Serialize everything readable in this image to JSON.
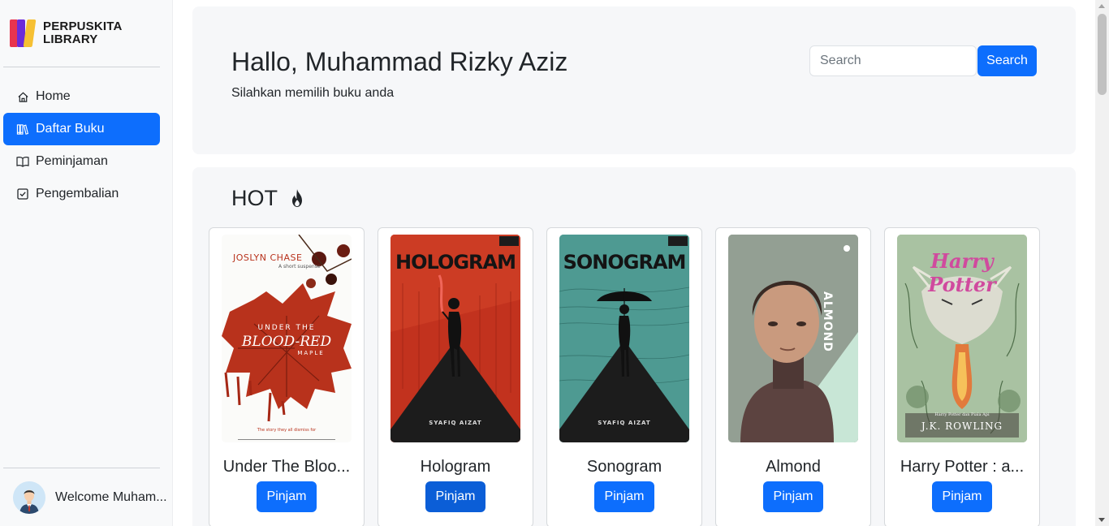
{
  "brand": {
    "line1": "PERPUSKITA",
    "line2": "LIBRARY"
  },
  "sidebar": {
    "items": [
      {
        "label": "Home",
        "icon": "home-icon"
      },
      {
        "label": "Daftar Buku",
        "icon": "books-icon",
        "active": true
      },
      {
        "label": "Peminjaman",
        "icon": "book-open-icon"
      },
      {
        "label": "Pengembalian",
        "icon": "check-square-icon"
      }
    ],
    "user_label": "Welcome Muham..."
  },
  "hero": {
    "greeting": "Hallo, Muhammad Rizky Aziz",
    "subtitle": "Silahkan memilih buku anda",
    "search_placeholder": "Search",
    "search_button": "Search"
  },
  "hot": {
    "title": "HOT",
    "books": [
      {
        "title": "Under The Bloo...",
        "button": "Pinjam",
        "cover_lines": [
          "JOSLYN CHASE",
          "A short suspense",
          "UNDER THE",
          "BLOOD-RED",
          "MAPLE",
          "The story they all dismiss for"
        ]
      },
      {
        "title": "Hologram",
        "button": "Pinjam",
        "cover_lines": [
          "HOLOGRAM",
          "SYAFIQ AIZAT"
        ]
      },
      {
        "title": "Sonogram",
        "button": "Pinjam",
        "cover_lines": [
          "SONOGRAM",
          "SYAFIQ AIZAT"
        ]
      },
      {
        "title": "Almond",
        "button": "Pinjam",
        "cover_lines": [
          "ALMOND"
        ]
      },
      {
        "title": "Harry Potter : a...",
        "button": "Pinjam",
        "cover_lines": [
          "Harry Potter",
          "Harry Potter dan Piala Api",
          "J.K. ROWLING"
        ]
      }
    ]
  },
  "colors": {
    "primary": "#0d6efd",
    "panel": "#f6f7f9",
    "sidebar": "#f8f9fa"
  }
}
